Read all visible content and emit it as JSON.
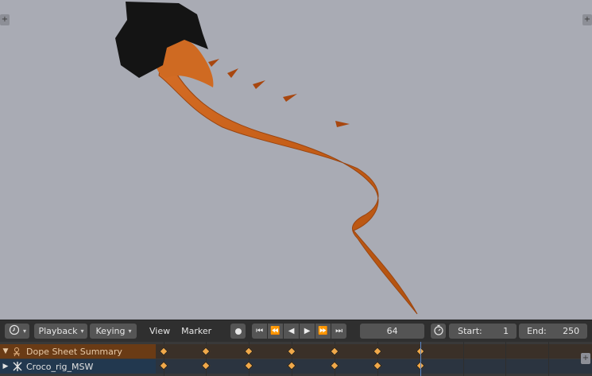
{
  "viewport": {
    "background_color": "#a9abb4",
    "model_color": "#c8621c",
    "head_color": "#141414"
  },
  "timeline_header": {
    "editor_type_icon": "clock-icon",
    "playback_label": "Playback",
    "keying_label": "Keying",
    "view_label": "View",
    "marker_label": "Marker",
    "current_frame": "64",
    "start_label": "Start:",
    "start_value": "1",
    "end_label": "End:",
    "end_value": "250"
  },
  "channels": [
    {
      "label": "Dope Sheet Summary",
      "icon": "dopesheet-icon",
      "expanded": true
    },
    {
      "label": "Croco_rig_MSW",
      "icon": "armature-icon",
      "expanded": false
    }
  ],
  "keyframe_count_per_row": 7,
  "corner_plus": "+"
}
